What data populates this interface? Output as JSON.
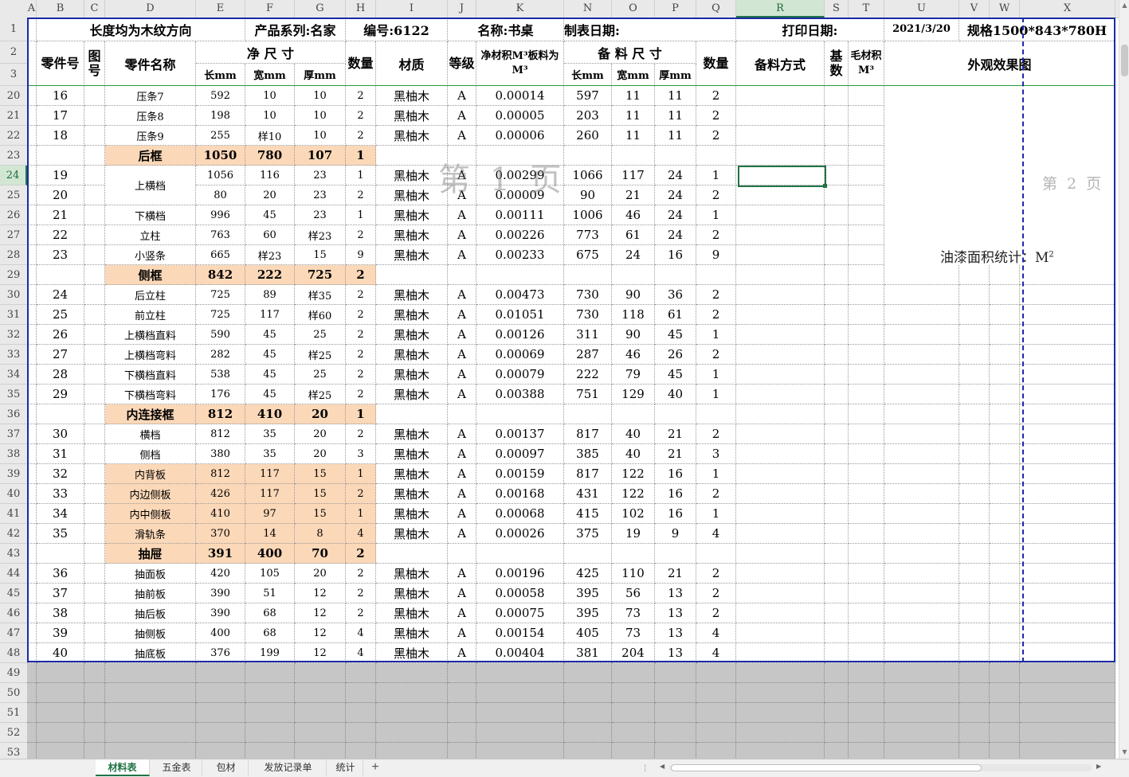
{
  "app": {
    "name": "Excel"
  },
  "columns": [
    "A",
    "B",
    "C",
    "D",
    "E",
    "F",
    "G",
    "H",
    "I",
    "J",
    "K",
    "N",
    "O",
    "P",
    "Q",
    "R",
    "S",
    "T",
    "U",
    "V",
    "W",
    "X"
  ],
  "selected_column": "R",
  "row_numbers": [
    "1",
    "2",
    "3",
    "20",
    "21",
    "22",
    "23",
    "24",
    "25",
    "26",
    "27",
    "28",
    "29",
    "30",
    "31",
    "32",
    "33",
    "34",
    "35",
    "36",
    "37",
    "38",
    "39",
    "40",
    "41",
    "42",
    "43",
    "44",
    "45",
    "46",
    "47",
    "48",
    "49",
    "50",
    "51",
    "52",
    "53"
  ],
  "selected_row": "24",
  "title_row": {
    "length_note": "长度均为木纹方向",
    "series": "产品系列:名家",
    "code": "编号:6122",
    "name": "名称:书桌",
    "made_date": "制表日期:",
    "print_date_label": "打印日期:",
    "print_date": "2021/3/20",
    "spec": "规格1500*843*780H"
  },
  "header": {
    "part_no": "零件号",
    "figure_no": "图号",
    "part_name": "零件名称",
    "net_size": "净 尺 寸",
    "len": "长mm",
    "wid": "宽mm",
    "thk": "厚mm",
    "qty": "数量",
    "material": "材质",
    "grade": "等级",
    "net_volume": "净材积M³板料为M³",
    "prep_size": "备 料 尺 寸",
    "prep_len": "长mm",
    "prep_wid": "宽mm",
    "prep_thk": "厚mm",
    "prep_qty": "数量",
    "prep_method": "备料方式",
    "base_count": "基数",
    "rough_volume": "毛材积M³",
    "appearance": "外观效果图"
  },
  "rows": [
    {
      "type": "part",
      "no": "16",
      "name": "压条7",
      "l": "592",
      "w": "10",
      "t": "10",
      "q": "2",
      "mat": "黑柚木",
      "g": "A",
      "vol": "0.00014",
      "pl": "597",
      "pw": "11",
      "pt": "11",
      "pq": "2"
    },
    {
      "type": "part",
      "no": "17",
      "name": "压条8",
      "l": "198",
      "w": "10",
      "t": "10",
      "q": "2",
      "mat": "黑柚木",
      "g": "A",
      "vol": "0.00005",
      "pl": "203",
      "pw": "11",
      "pt": "11",
      "pq": "2"
    },
    {
      "type": "part",
      "no": "18",
      "name": "压条9",
      "l": "255",
      "w": "样10",
      "t": "10",
      "q": "2",
      "mat": "黑柚木",
      "g": "A",
      "vol": "0.00006",
      "pl": "260",
      "pw": "11",
      "pt": "11",
      "pq": "2"
    },
    {
      "type": "group",
      "name": "后框",
      "l": "1050",
      "w": "780",
      "t": "107",
      "q": "1"
    },
    {
      "type": "part",
      "no": "19",
      "name": "上横档",
      "l": "1056",
      "w": "116",
      "t": "23",
      "q": "1",
      "mat": "黑柚木",
      "g": "A",
      "vol": "0.00299",
      "pl": "1066",
      "pw": "117",
      "pt": "24",
      "pq": "1"
    },
    {
      "type": "part",
      "no": "20",
      "name": "",
      "l": "80",
      "w": "20",
      "t": "23",
      "q": "2",
      "mat": "黑柚木",
      "g": "A",
      "vol": "0.00009",
      "pl": "90",
      "pw": "21",
      "pt": "24",
      "pq": "2"
    },
    {
      "type": "part",
      "no": "21",
      "name": "下横档",
      "l": "996",
      "w": "45",
      "t": "23",
      "q": "1",
      "mat": "黑柚木",
      "g": "A",
      "vol": "0.00111",
      "pl": "1006",
      "pw": "46",
      "pt": "24",
      "pq": "1"
    },
    {
      "type": "part",
      "no": "22",
      "name": "立柱",
      "l": "763",
      "w": "60",
      "t": "样23",
      "q": "2",
      "mat": "黑柚木",
      "g": "A",
      "vol": "0.00226",
      "pl": "773",
      "pw": "61",
      "pt": "24",
      "pq": "2"
    },
    {
      "type": "part",
      "no": "23",
      "name": "小竖条",
      "l": "665",
      "w": "样23",
      "t": "15",
      "q": "9",
      "mat": "黑柚木",
      "g": "A",
      "vol": "0.00233",
      "pl": "675",
      "pw": "24",
      "pt": "16",
      "pq": "9"
    },
    {
      "type": "group",
      "name": "侧框",
      "l": "842",
      "w": "222",
      "t": "725",
      "q": "2"
    },
    {
      "type": "part",
      "no": "24",
      "name": "后立柱",
      "l": "725",
      "w": "89",
      "t": "样35",
      "q": "2",
      "mat": "黑柚木",
      "g": "A",
      "vol": "0.00473",
      "pl": "730",
      "pw": "90",
      "pt": "36",
      "pq": "2"
    },
    {
      "type": "part",
      "no": "25",
      "name": "前立柱",
      "l": "725",
      "w": "117",
      "t": "样60",
      "q": "2",
      "mat": "黑柚木",
      "g": "A",
      "vol": "0.01051",
      "pl": "730",
      "pw": "118",
      "pt": "61",
      "pq": "2"
    },
    {
      "type": "part",
      "no": "26",
      "name": "上横档直料",
      "l": "590",
      "w": "45",
      "t": "25",
      "q": "2",
      "mat": "黑柚木",
      "g": "A",
      "vol": "0.00126",
      "pl": "311",
      "pw": "90",
      "pt": "45",
      "pq": "1"
    },
    {
      "type": "part",
      "no": "27",
      "name": "上横档弯料",
      "l": "282",
      "w": "45",
      "t": "样25",
      "q": "2",
      "mat": "黑柚木",
      "g": "A",
      "vol": "0.00069",
      "pl": "287",
      "pw": "46",
      "pt": "26",
      "pq": "2"
    },
    {
      "type": "part",
      "no": "28",
      "name": "下横档直料",
      "l": "538",
      "w": "45",
      "t": "25",
      "q": "2",
      "mat": "黑柚木",
      "g": "A",
      "vol": "0.00079",
      "pl": "222",
      "pw": "79",
      "pt": "45",
      "pq": "1"
    },
    {
      "type": "part",
      "no": "29",
      "name": "下横档弯料",
      "l": "176",
      "w": "45",
      "t": "样25",
      "q": "2",
      "mat": "黑柚木",
      "g": "A",
      "vol": "0.00388",
      "pl": "751",
      "pw": "129",
      "pt": "40",
      "pq": "1"
    },
    {
      "type": "group",
      "name": "内连接框",
      "l": "812",
      "w": "410",
      "t": "20",
      "q": "1"
    },
    {
      "type": "part",
      "no": "30",
      "name": "横档",
      "l": "812",
      "w": "35",
      "t": "20",
      "q": "2",
      "mat": "黑柚木",
      "g": "A",
      "vol": "0.00137",
      "pl": "817",
      "pw": "40",
      "pt": "21",
      "pq": "2"
    },
    {
      "type": "part",
      "no": "31",
      "name": "侧档",
      "l": "380",
      "w": "35",
      "t": "20",
      "q": "3",
      "mat": "黑柚木",
      "g": "A",
      "vol": "0.00097",
      "pl": "385",
      "pw": "40",
      "pt": "21",
      "pq": "3"
    },
    {
      "type": "panel",
      "no": "32",
      "name": "内背板",
      "l": "812",
      "w": "117",
      "t": "15",
      "q": "1",
      "mat": "黑柚木",
      "g": "A",
      "vol": "0.00159",
      "pl": "817",
      "pw": "122",
      "pt": "16",
      "pq": "1"
    },
    {
      "type": "panel",
      "no": "33",
      "name": "内边侧板",
      "l": "426",
      "w": "117",
      "t": "15",
      "q": "2",
      "mat": "黑柚木",
      "g": "A",
      "vol": "0.00168",
      "pl": "431",
      "pw": "122",
      "pt": "16",
      "pq": "2"
    },
    {
      "type": "panel",
      "no": "34",
      "name": "内中侧板",
      "l": "410",
      "w": "97",
      "t": "15",
      "q": "1",
      "mat": "黑柚木",
      "g": "A",
      "vol": "0.00068",
      "pl": "415",
      "pw": "102",
      "pt": "16",
      "pq": "1"
    },
    {
      "type": "panel",
      "no": "35",
      "name": "滑轨条",
      "l": "370",
      "w": "14",
      "t": "8",
      "q": "4",
      "mat": "黑柚木",
      "g": "A",
      "vol": "0.00026",
      "pl": "375",
      "pw": "19",
      "pt": "9",
      "pq": "4"
    },
    {
      "type": "group",
      "name": "抽屉",
      "l": "391",
      "w": "400",
      "t": "70",
      "q": "2"
    },
    {
      "type": "part",
      "no": "36",
      "name": "抽面板",
      "l": "420",
      "w": "105",
      "t": "20",
      "q": "2",
      "mat": "黑柚木",
      "g": "A",
      "vol": "0.00196",
      "pl": "425",
      "pw": "110",
      "pt": "21",
      "pq": "2"
    },
    {
      "type": "part",
      "no": "37",
      "name": "抽前板",
      "l": "390",
      "w": "51",
      "t": "12",
      "q": "2",
      "mat": "黑柚木",
      "g": "A",
      "vol": "0.00058",
      "pl": "395",
      "pw": "56",
      "pt": "13",
      "pq": "2"
    },
    {
      "type": "part",
      "no": "38",
      "name": "抽后板",
      "l": "390",
      "w": "68",
      "t": "12",
      "q": "2",
      "mat": "黑柚木",
      "g": "A",
      "vol": "0.00075",
      "pl": "395",
      "pw": "73",
      "pt": "13",
      "pq": "2"
    },
    {
      "type": "part",
      "no": "39",
      "name": "抽侧板",
      "l": "400",
      "w": "68",
      "t": "12",
      "q": "4",
      "mat": "黑柚木",
      "g": "A",
      "vol": "0.00154",
      "pl": "405",
      "pw": "73",
      "pt": "13",
      "pq": "4"
    },
    {
      "type": "part",
      "no": "40",
      "name": "抽底板",
      "l": "376",
      "w": "199",
      "t": "12",
      "q": "4",
      "mat": "黑柚木",
      "g": "A",
      "vol": "0.00404",
      "pl": "381",
      "pw": "204",
      "pt": "13",
      "pq": "4"
    }
  ],
  "watermark_page1": "第 1 页",
  "watermark_page2": "第 2 页",
  "paint_area": {
    "label": "油漆面积统计：M",
    "sup": "2"
  },
  "sheet_tabs": [
    "材料表",
    "五金表",
    "包材",
    "发放记录单",
    "统计"
  ],
  "active_tab": "材料表",
  "add_sheet": "+",
  "colors": {
    "group_fill": "#fbd8b8",
    "frame": "#1b2aa6",
    "select": "#217346",
    "empty_fill": "#c6c6c6"
  }
}
